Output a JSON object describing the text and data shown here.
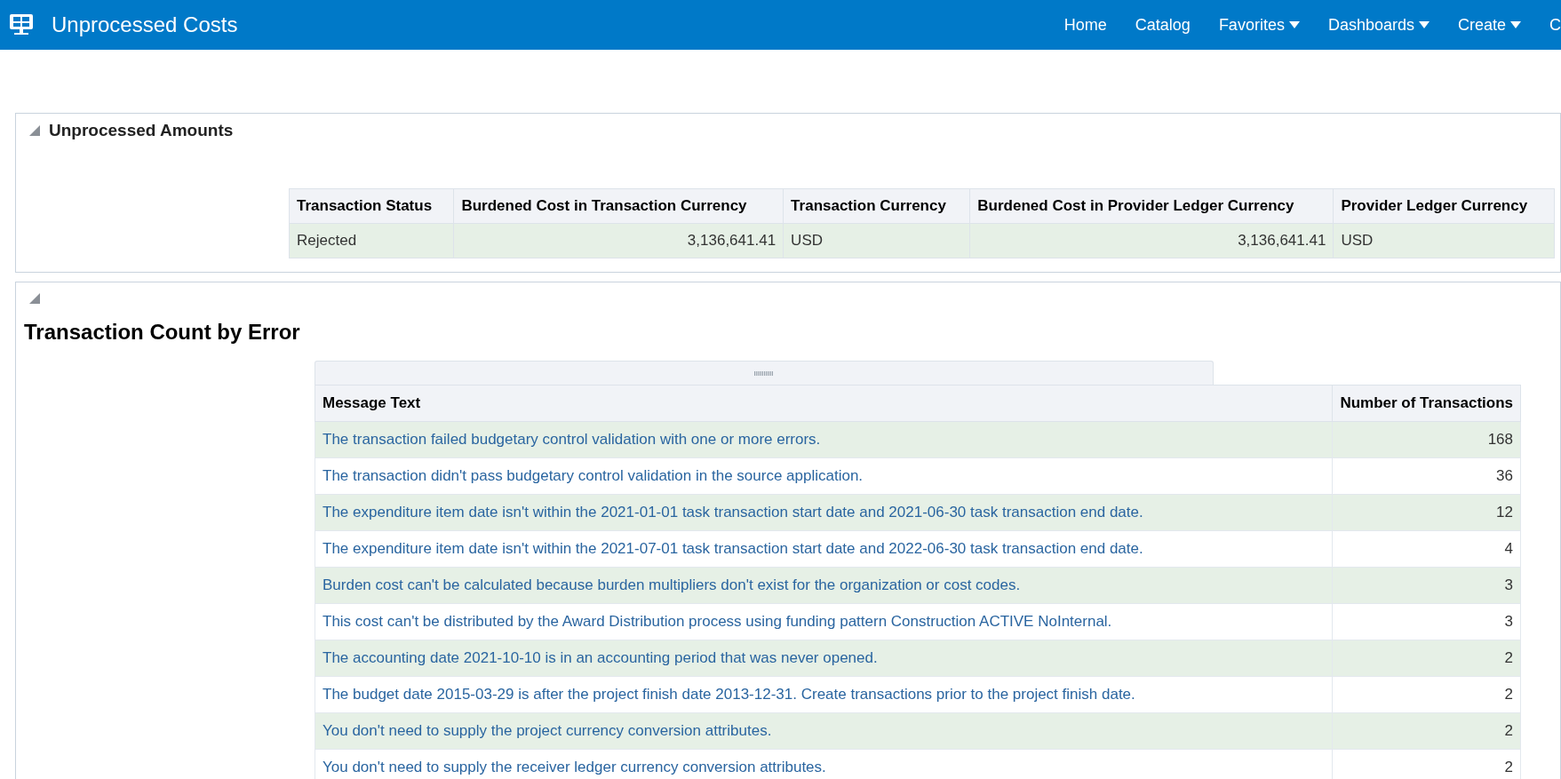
{
  "header": {
    "title": "Unprocessed Costs",
    "nav": [
      {
        "label": "Home",
        "menu": false
      },
      {
        "label": "Catalog",
        "menu": false
      },
      {
        "label": "Favorites",
        "menu": true
      },
      {
        "label": "Dashboards",
        "menu": true
      },
      {
        "label": "Create",
        "menu": true
      },
      {
        "label": "C",
        "menu": false
      }
    ]
  },
  "amounts": {
    "title": "Unprocessed Amounts",
    "expanded": true,
    "columns": [
      {
        "label": "Transaction Status",
        "kind": "text"
      },
      {
        "label": "Burdened Cost in Transaction Currency",
        "kind": "amount"
      },
      {
        "label": "Transaction Currency",
        "kind": "text"
      },
      {
        "label": "Burdened Cost in Provider Ledger Currency",
        "kind": "amount"
      },
      {
        "label": "Provider Ledger Currency",
        "kind": "text"
      }
    ],
    "rows": [
      [
        "Rejected",
        "3,136,641.41",
        "USD",
        "3,136,641.41",
        "USD"
      ]
    ]
  },
  "errors": {
    "title": "Transaction Count by Error",
    "expanded": true,
    "columns": [
      "Message Text",
      "Number of Transactions"
    ],
    "rows": [
      {
        "message": "The transaction failed budgetary control validation with one or more errors.",
        "count": "168"
      },
      {
        "message": "The transaction didn't pass budgetary control validation in the source application.",
        "count": "36"
      },
      {
        "message": "The expenditure item date isn't within the 2021-01-01 task transaction start date and 2021-06-30 task transaction end date.",
        "count": "12"
      },
      {
        "message": "The expenditure item date isn't within the 2021-07-01 task transaction start date and 2022-06-30 task transaction end date.",
        "count": "4"
      },
      {
        "message": "Burden cost can't be calculated because burden multipliers don't exist for the organization or cost codes.",
        "count": "3"
      },
      {
        "message": "This cost can't be distributed by the Award Distribution process using funding pattern Construction ACTIVE NoInternal.",
        "count": "3"
      },
      {
        "message": "The accounting date 2021-10-10 is in an accounting period that was never opened.",
        "count": "2"
      },
      {
        "message": "The budget date 2015-03-29 is after the project finish date 2013-12-31. Create transactions prior to the project finish date.",
        "count": "2"
      },
      {
        "message": "You don't need to supply the project currency conversion attributes.",
        "count": "2"
      },
      {
        "message": "You don't need to supply the receiver ledger currency conversion attributes.",
        "count": "2"
      }
    ]
  }
}
